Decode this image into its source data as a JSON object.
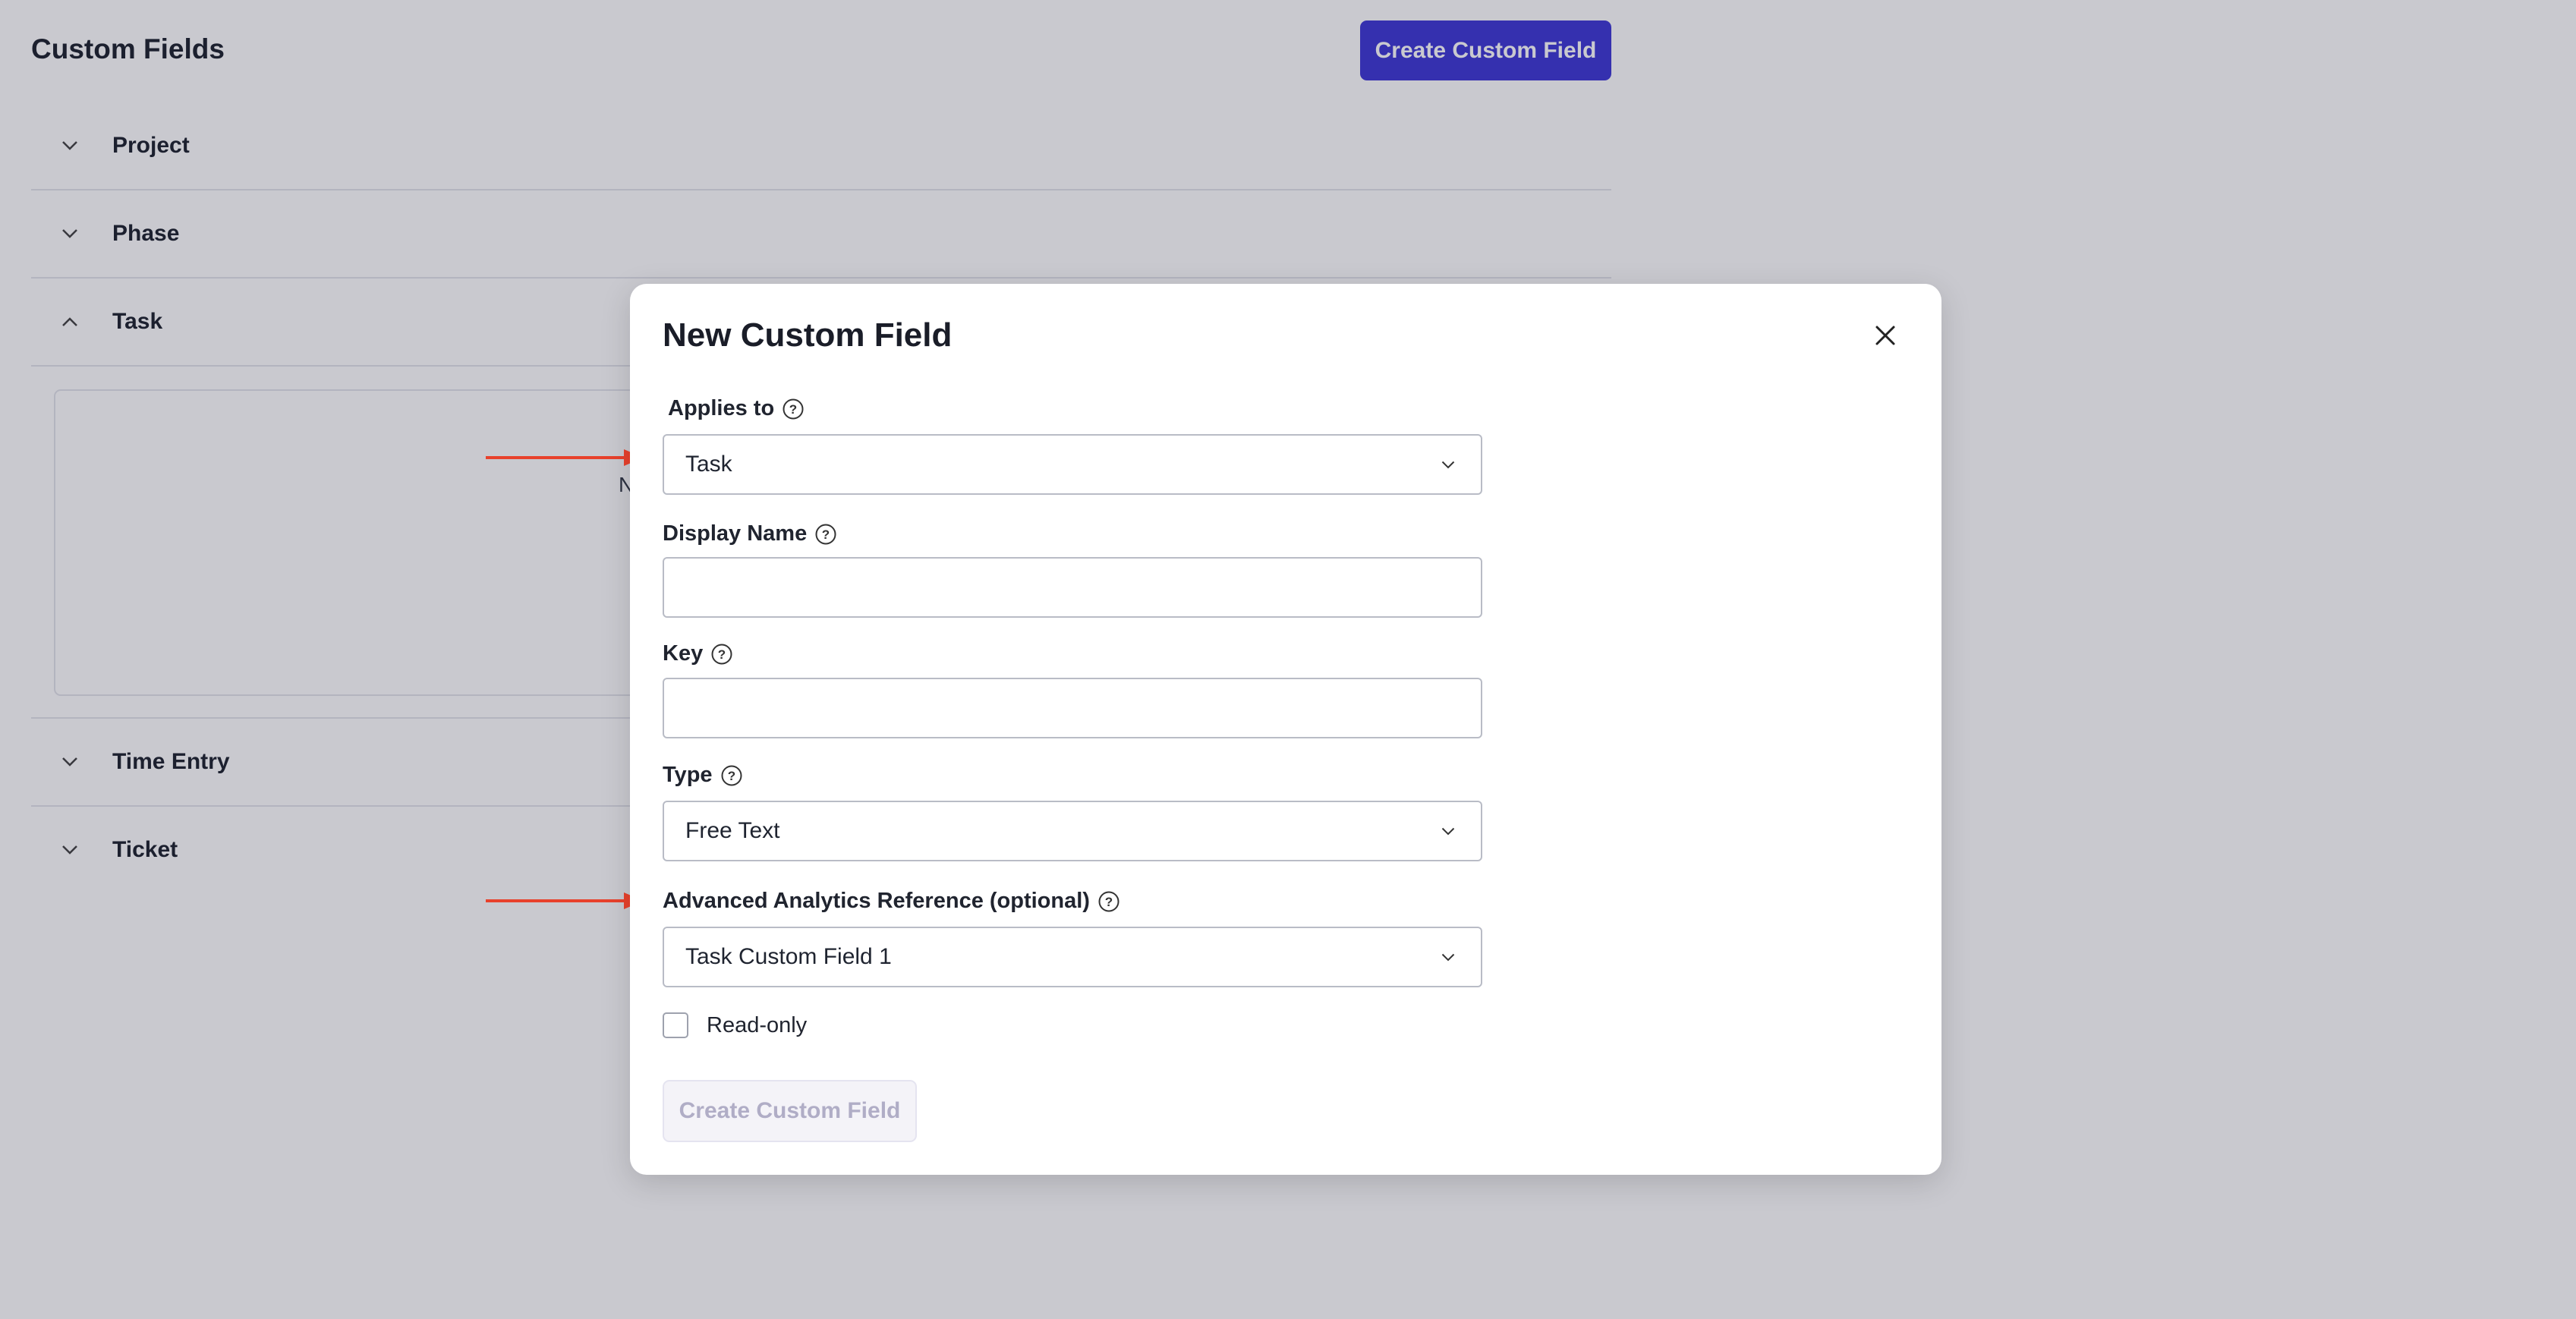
{
  "page": {
    "title": "Custom Fields",
    "create_button": "Create Custom Field"
  },
  "sections": [
    {
      "label": "Project",
      "expanded": false
    },
    {
      "label": "Phase",
      "expanded": false
    },
    {
      "label": "Task",
      "expanded": true
    },
    {
      "label": "Time Entry",
      "expanded": false
    },
    {
      "label": "Ticket",
      "expanded": false
    }
  ],
  "task_panel": {
    "visible_text": "N"
  },
  "modal": {
    "title": "New Custom Field",
    "applies_to": {
      "label": "Applies to",
      "value": "Task"
    },
    "display_name": {
      "label": "Display Name",
      "value": ""
    },
    "key": {
      "label": "Key",
      "value": ""
    },
    "type": {
      "label": "Type",
      "value": "Free Text"
    },
    "analytics_reference": {
      "label": "Advanced Analytics Reference (optional)",
      "value": "Task Custom Field 1"
    },
    "read_only": {
      "label": "Read-only",
      "checked": false
    },
    "submit_button": "Create Custom Field"
  },
  "colors": {
    "primary": "#3f38d6",
    "annotation_arrow": "#e8412c",
    "overlay": "#c9c8d1"
  },
  "icons": [
    "chevron-down-icon",
    "chevron-up-icon",
    "close-icon",
    "help-icon",
    "arrow-right-icon"
  ]
}
